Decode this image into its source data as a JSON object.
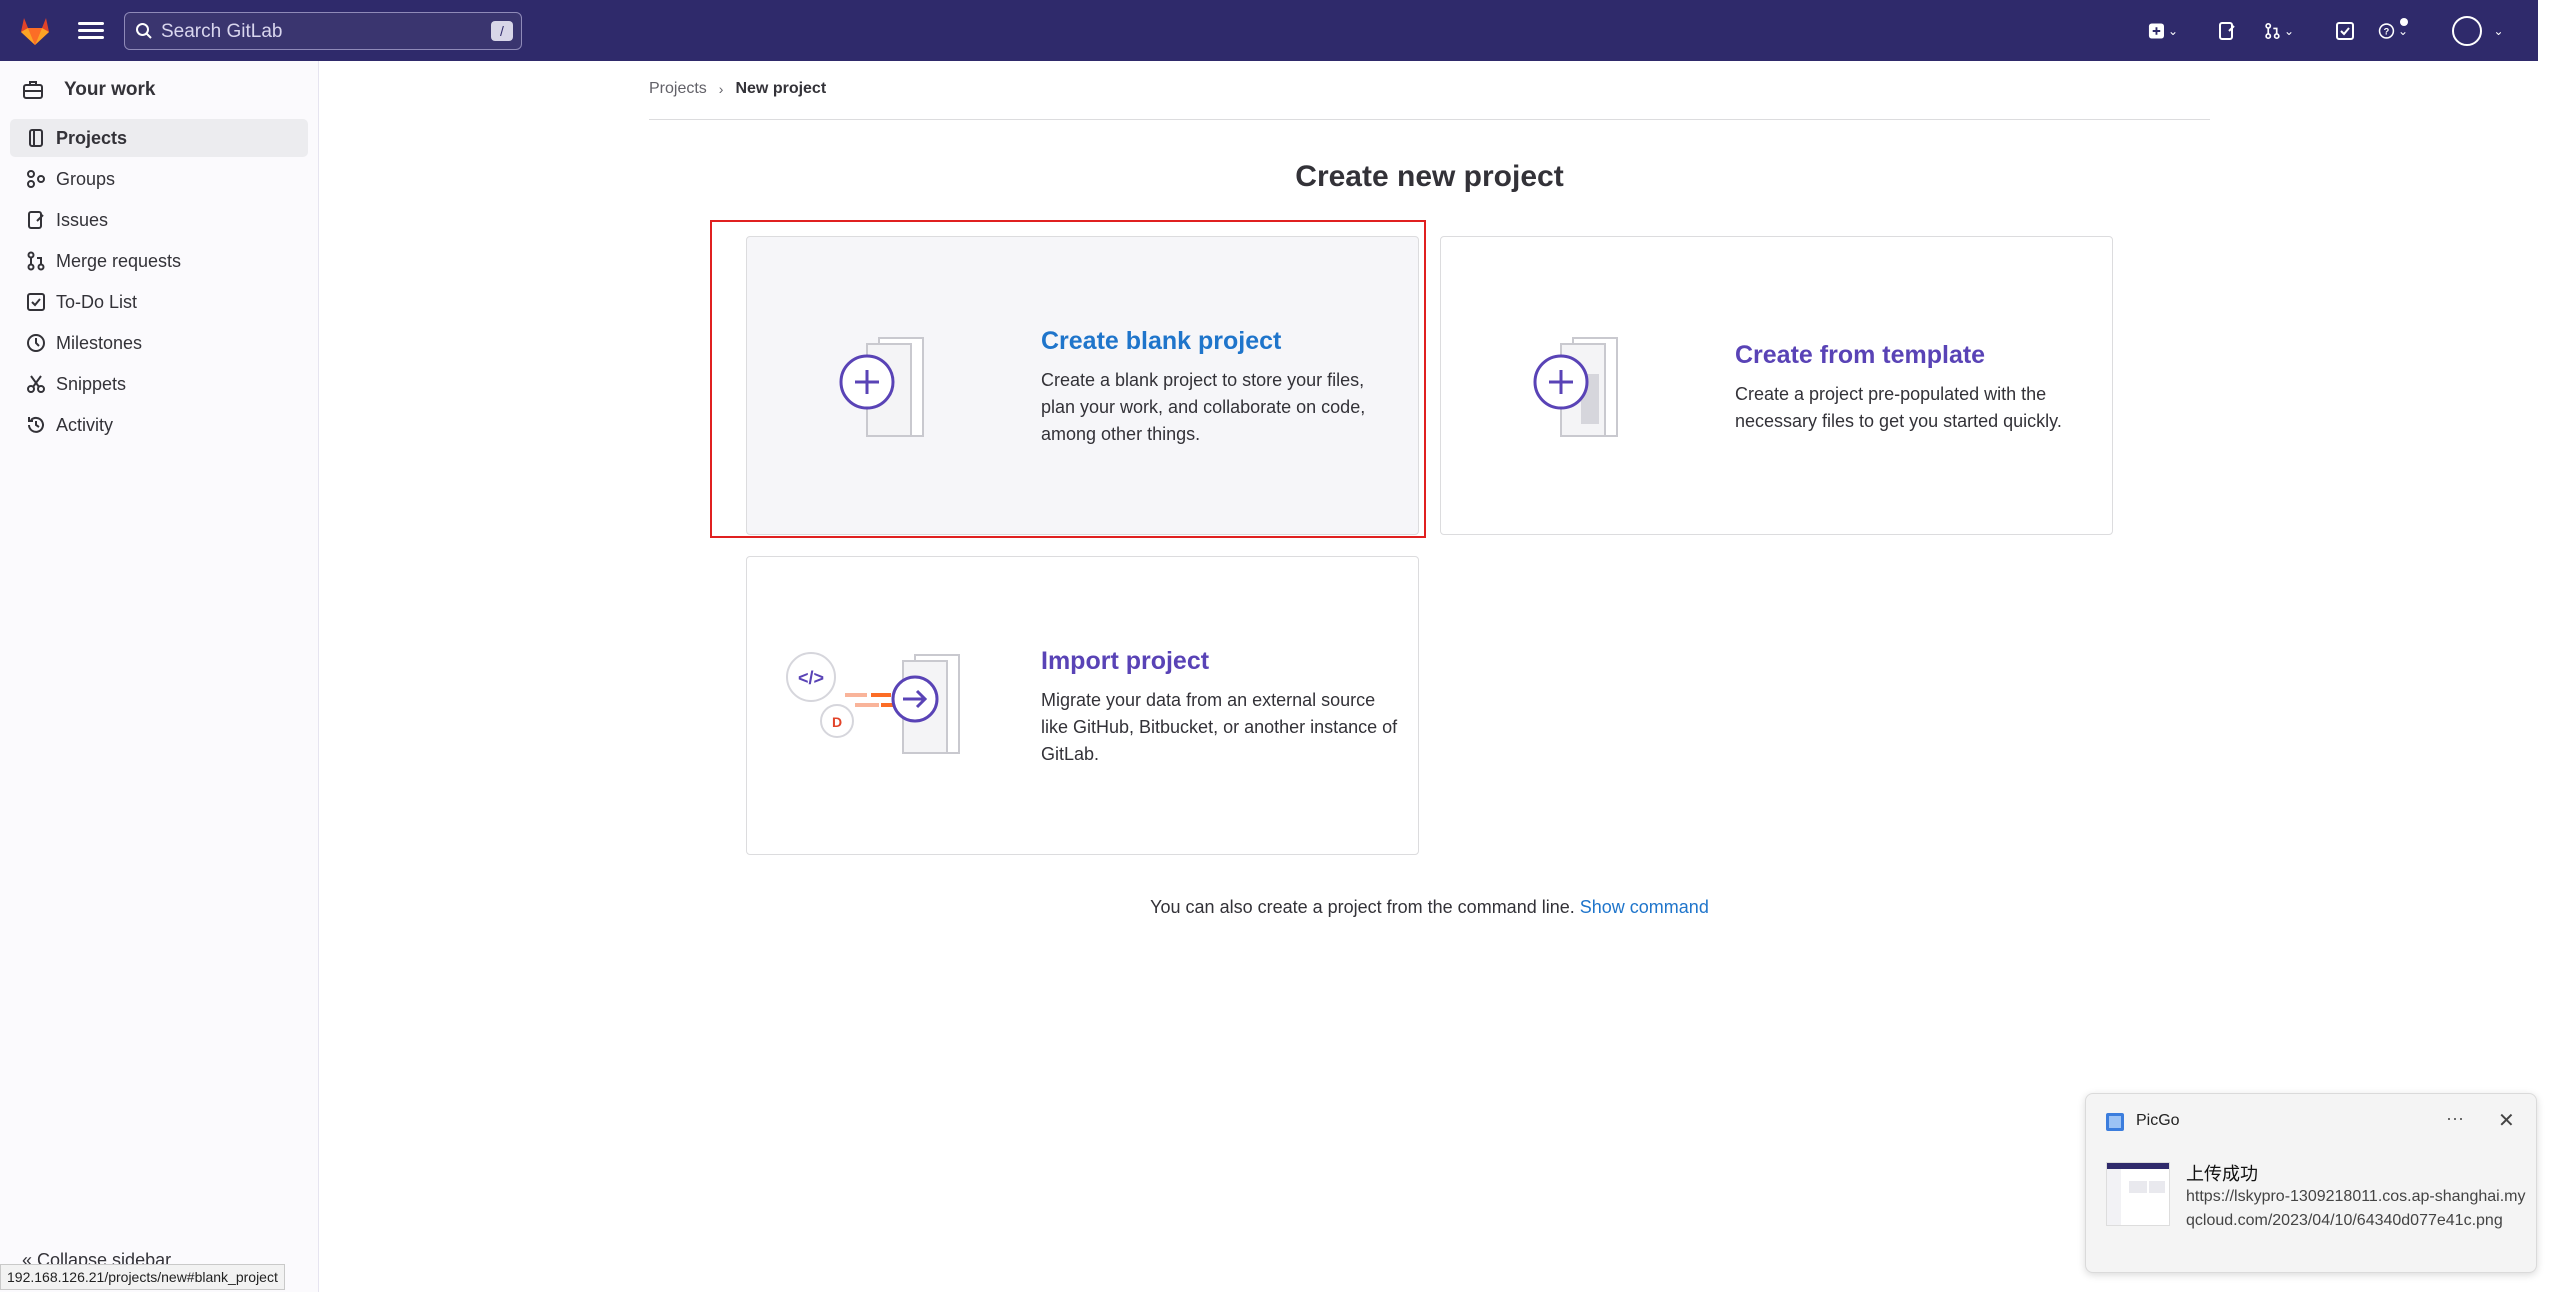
{
  "topbar": {
    "search_placeholder": "Search GitLab",
    "search_shortcut": "/"
  },
  "sidebar": {
    "section_title": "Your work",
    "items": [
      {
        "label": "Projects",
        "icon": "project-icon",
        "active": true
      },
      {
        "label": "Groups",
        "icon": "group-icon"
      },
      {
        "label": "Issues",
        "icon": "issues-icon"
      },
      {
        "label": "Merge requests",
        "icon": "merge-request-icon"
      },
      {
        "label": "To-Do List",
        "icon": "todo-icon"
      },
      {
        "label": "Milestones",
        "icon": "clock-icon"
      },
      {
        "label": "Snippets",
        "icon": "scissors-icon"
      },
      {
        "label": "Activity",
        "icon": "history-icon"
      }
    ],
    "collapse_label": "Collapse sidebar"
  },
  "statusbar": {
    "url": "192.168.126.21/projects/new#blank_project"
  },
  "breadcrumb": {
    "parent": "Projects",
    "current": "New project"
  },
  "main": {
    "title": "Create new project",
    "cards": {
      "blank": {
        "title": "Create blank project",
        "desc": "Create a blank project to store your files, plan your work, and collaborate on code, among other things."
      },
      "template": {
        "title": "Create from template",
        "desc": "Create a project pre-populated with the necessary files to get you started quickly."
      },
      "import": {
        "title": "Import project",
        "desc": "Migrate your data from an external source like GitHub, Bitbucket, or another instance of GitLab."
      }
    },
    "command_text": "You can also create a project from the command line.",
    "command_link": "Show command"
  },
  "toast": {
    "app_name": "PicGo",
    "title": "上传成功",
    "body": "https://lskypro-1309218011.cos.ap-shanghai.myqcloud.com/2023/04/10/64340d077e41c.png"
  },
  "colors": {
    "topbar": "#2f2a6b",
    "link_blue": "#1f75cb",
    "purple": "#5943b6",
    "highlight_red": "#e02020"
  }
}
